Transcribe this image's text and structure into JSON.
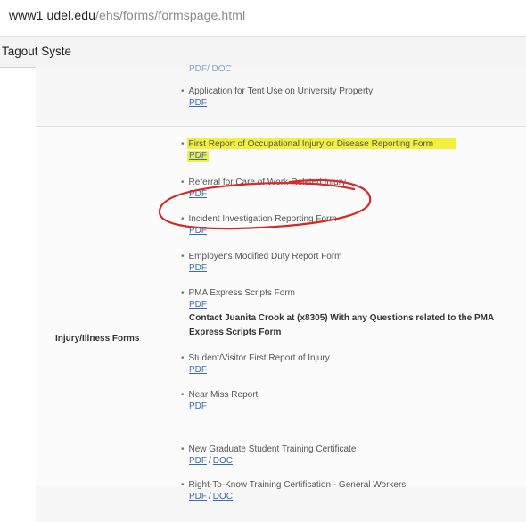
{
  "browser": {
    "url_domain": "www1.udel.edu",
    "url_path": "/ehs/forms/formspage.html",
    "tab_title": "Tagout Syste"
  },
  "sections": {
    "top_items": [
      {
        "title": "Application for Tent Use on University Property",
        "link": "PDF"
      }
    ],
    "injury": {
      "label": "Injury/Illness Forms",
      "items": [
        {
          "title": "First Report of Occupational Injury or Disease Reporting Form",
          "link": "PDF"
        },
        {
          "title": "Referral for Care of Work-Related Injury",
          "link": "PDF"
        },
        {
          "title": "Incident Investigation Reporting Form",
          "link": "PDF"
        },
        {
          "title": "Employer's Modified Duty Report Form",
          "link": "PDF"
        },
        {
          "title": "PMA Express Scripts Form",
          "link": "PDF"
        },
        {
          "title": "Student/Visitor First Report of Injury",
          "link": "PDF"
        },
        {
          "title": "Near Miss Report",
          "link": "PDF"
        }
      ],
      "pma_note": "Contact Juanita Crook at (x8305) With any Questions related to the PMA Express Scripts Form"
    },
    "training_items": [
      {
        "title": "New Graduate Student Training Certificate",
        "link1": "PDF",
        "link2": "DOC"
      },
      {
        "title": "Right-To-Know Training Certification - General Workers",
        "link1": "PDF",
        "link2": "DOC"
      }
    ]
  },
  "annotation": {
    "highlight_color": "#f2ef3d",
    "circle_color": "#d42a2a"
  }
}
